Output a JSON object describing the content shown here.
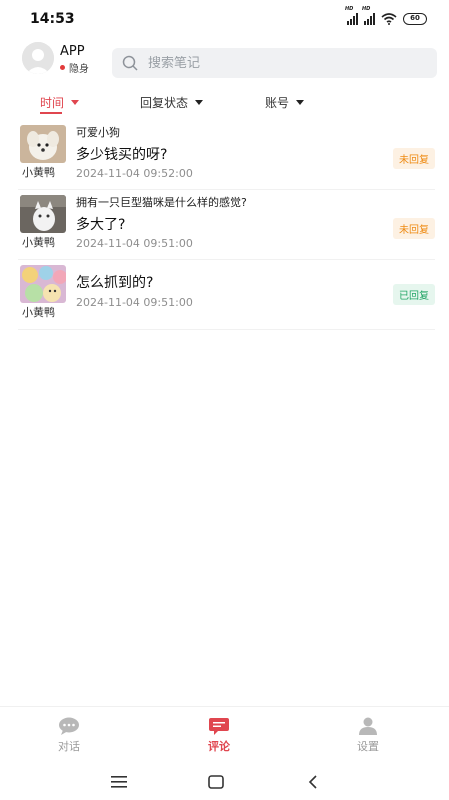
{
  "status_bar": {
    "time": "14:53",
    "network": "HD",
    "battery": "60"
  },
  "header": {
    "app_name": "APP",
    "status_label": "隐身"
  },
  "search": {
    "placeholder": "搜索笔记"
  },
  "filters": [
    {
      "label": "时间",
      "active": true
    },
    {
      "label": "回复状态",
      "active": false
    },
    {
      "label": "账号",
      "active": false
    }
  ],
  "comments": [
    {
      "note_title": "可爱小狗",
      "comment": "多少钱买的呀?",
      "time": "2024-11-04 09:52:00",
      "poster": "小黄鸭",
      "status": "未回复",
      "status_type": "pending"
    },
    {
      "note_title": "拥有一只巨型猫咪是什么样的感觉?",
      "comment": "多大了?",
      "time": "2024-11-04 09:51:00",
      "poster": "小黄鸭",
      "status": "未回复",
      "status_type": "pending"
    },
    {
      "note_title": "",
      "comment": "怎么抓到的?",
      "time": "2024-11-04 09:51:00",
      "poster": "小黄鸭",
      "status": "已回复",
      "status_type": "replied"
    }
  ],
  "bottom_nav": [
    {
      "label": "对话",
      "icon": "chat-bubble-icon",
      "active": false
    },
    {
      "label": "评论",
      "icon": "comment-icon",
      "active": true
    },
    {
      "label": "设置",
      "icon": "user-icon",
      "active": false
    }
  ],
  "colors": {
    "accent": "#e0464f",
    "pending": "#ee8a12",
    "replied": "#22a566"
  }
}
